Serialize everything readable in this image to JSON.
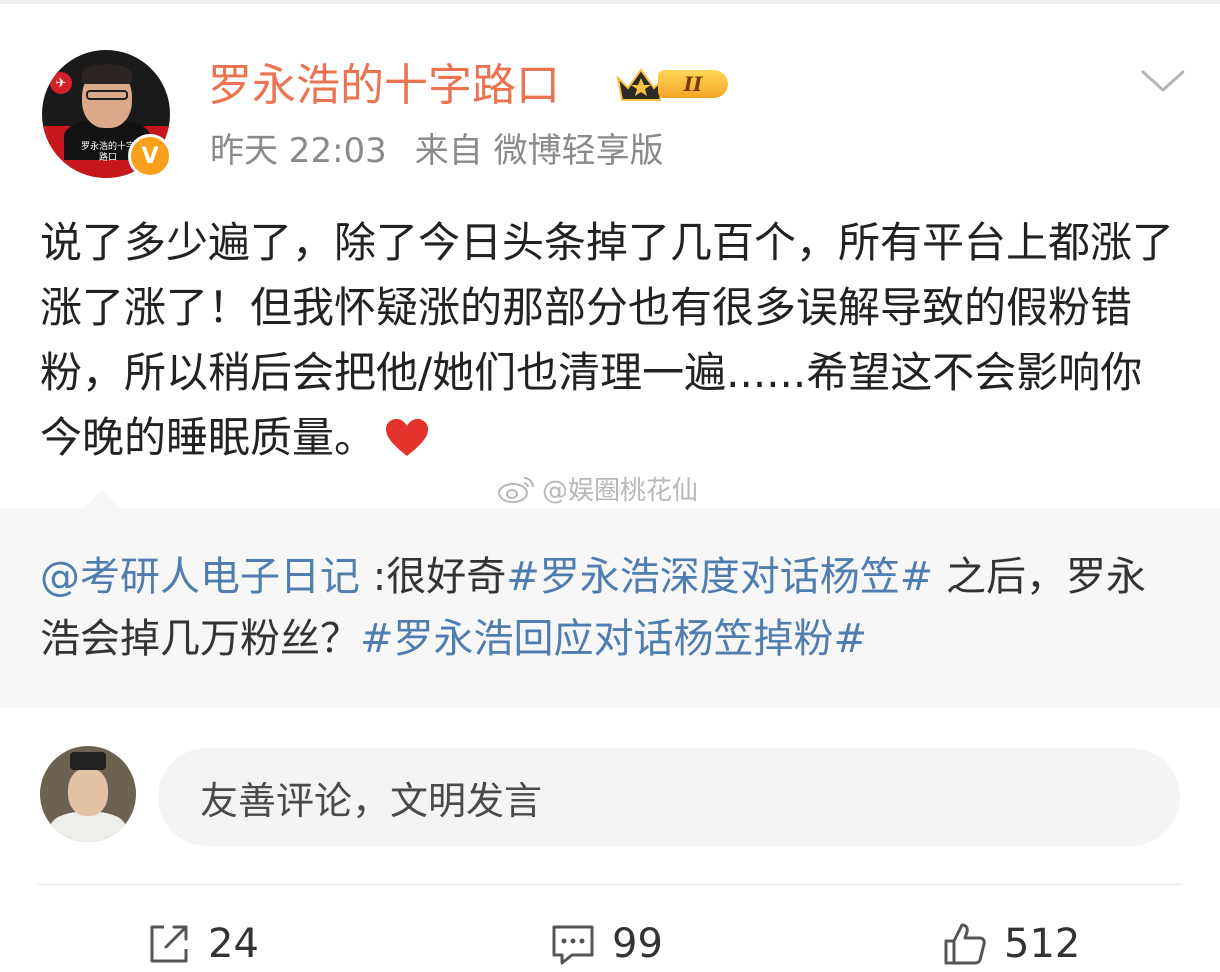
{
  "post": {
    "username": "罗永浩的十字路口",
    "avatar_caption": "罗永浩的十字路口",
    "verified_badge": "V",
    "level": "II",
    "timestamp": "昨天 22:03",
    "source": "来自 微博轻享版",
    "text": "说了多少遍了，除了今日头条掉了几百个，所有平台上都涨了涨了涨了！但我怀疑涨的那部分也有很多误解导致的假粉错粉，所以稍后会把他/她们也清理一遍......希望这不会影响你今晚的睡眠质量。",
    "watermark": "@娱圈桃花仙",
    "icons": [
      "chevron-down-icon",
      "heart-icon",
      "weibo-logo-icon",
      "crown-icon",
      "verified-icon"
    ]
  },
  "quote": {
    "mention": "@考研人电子日记",
    "text_before": " :很好奇",
    "hashtag1": "#罗永浩深度对话杨笠#",
    "text_middle": " 之后，罗永浩会掉几万粉丝？",
    "hashtag2": "#罗永浩回应对话杨笠掉粉#"
  },
  "comment": {
    "placeholder": "友善评论，文明发言"
  },
  "actions": {
    "repost_count": "24",
    "comment_count": "99",
    "like_count": "512"
  },
  "colors": {
    "username": "#eb7350",
    "link": "#507daf",
    "meta": "#8a8a8a",
    "badge": "#f7a11a"
  }
}
